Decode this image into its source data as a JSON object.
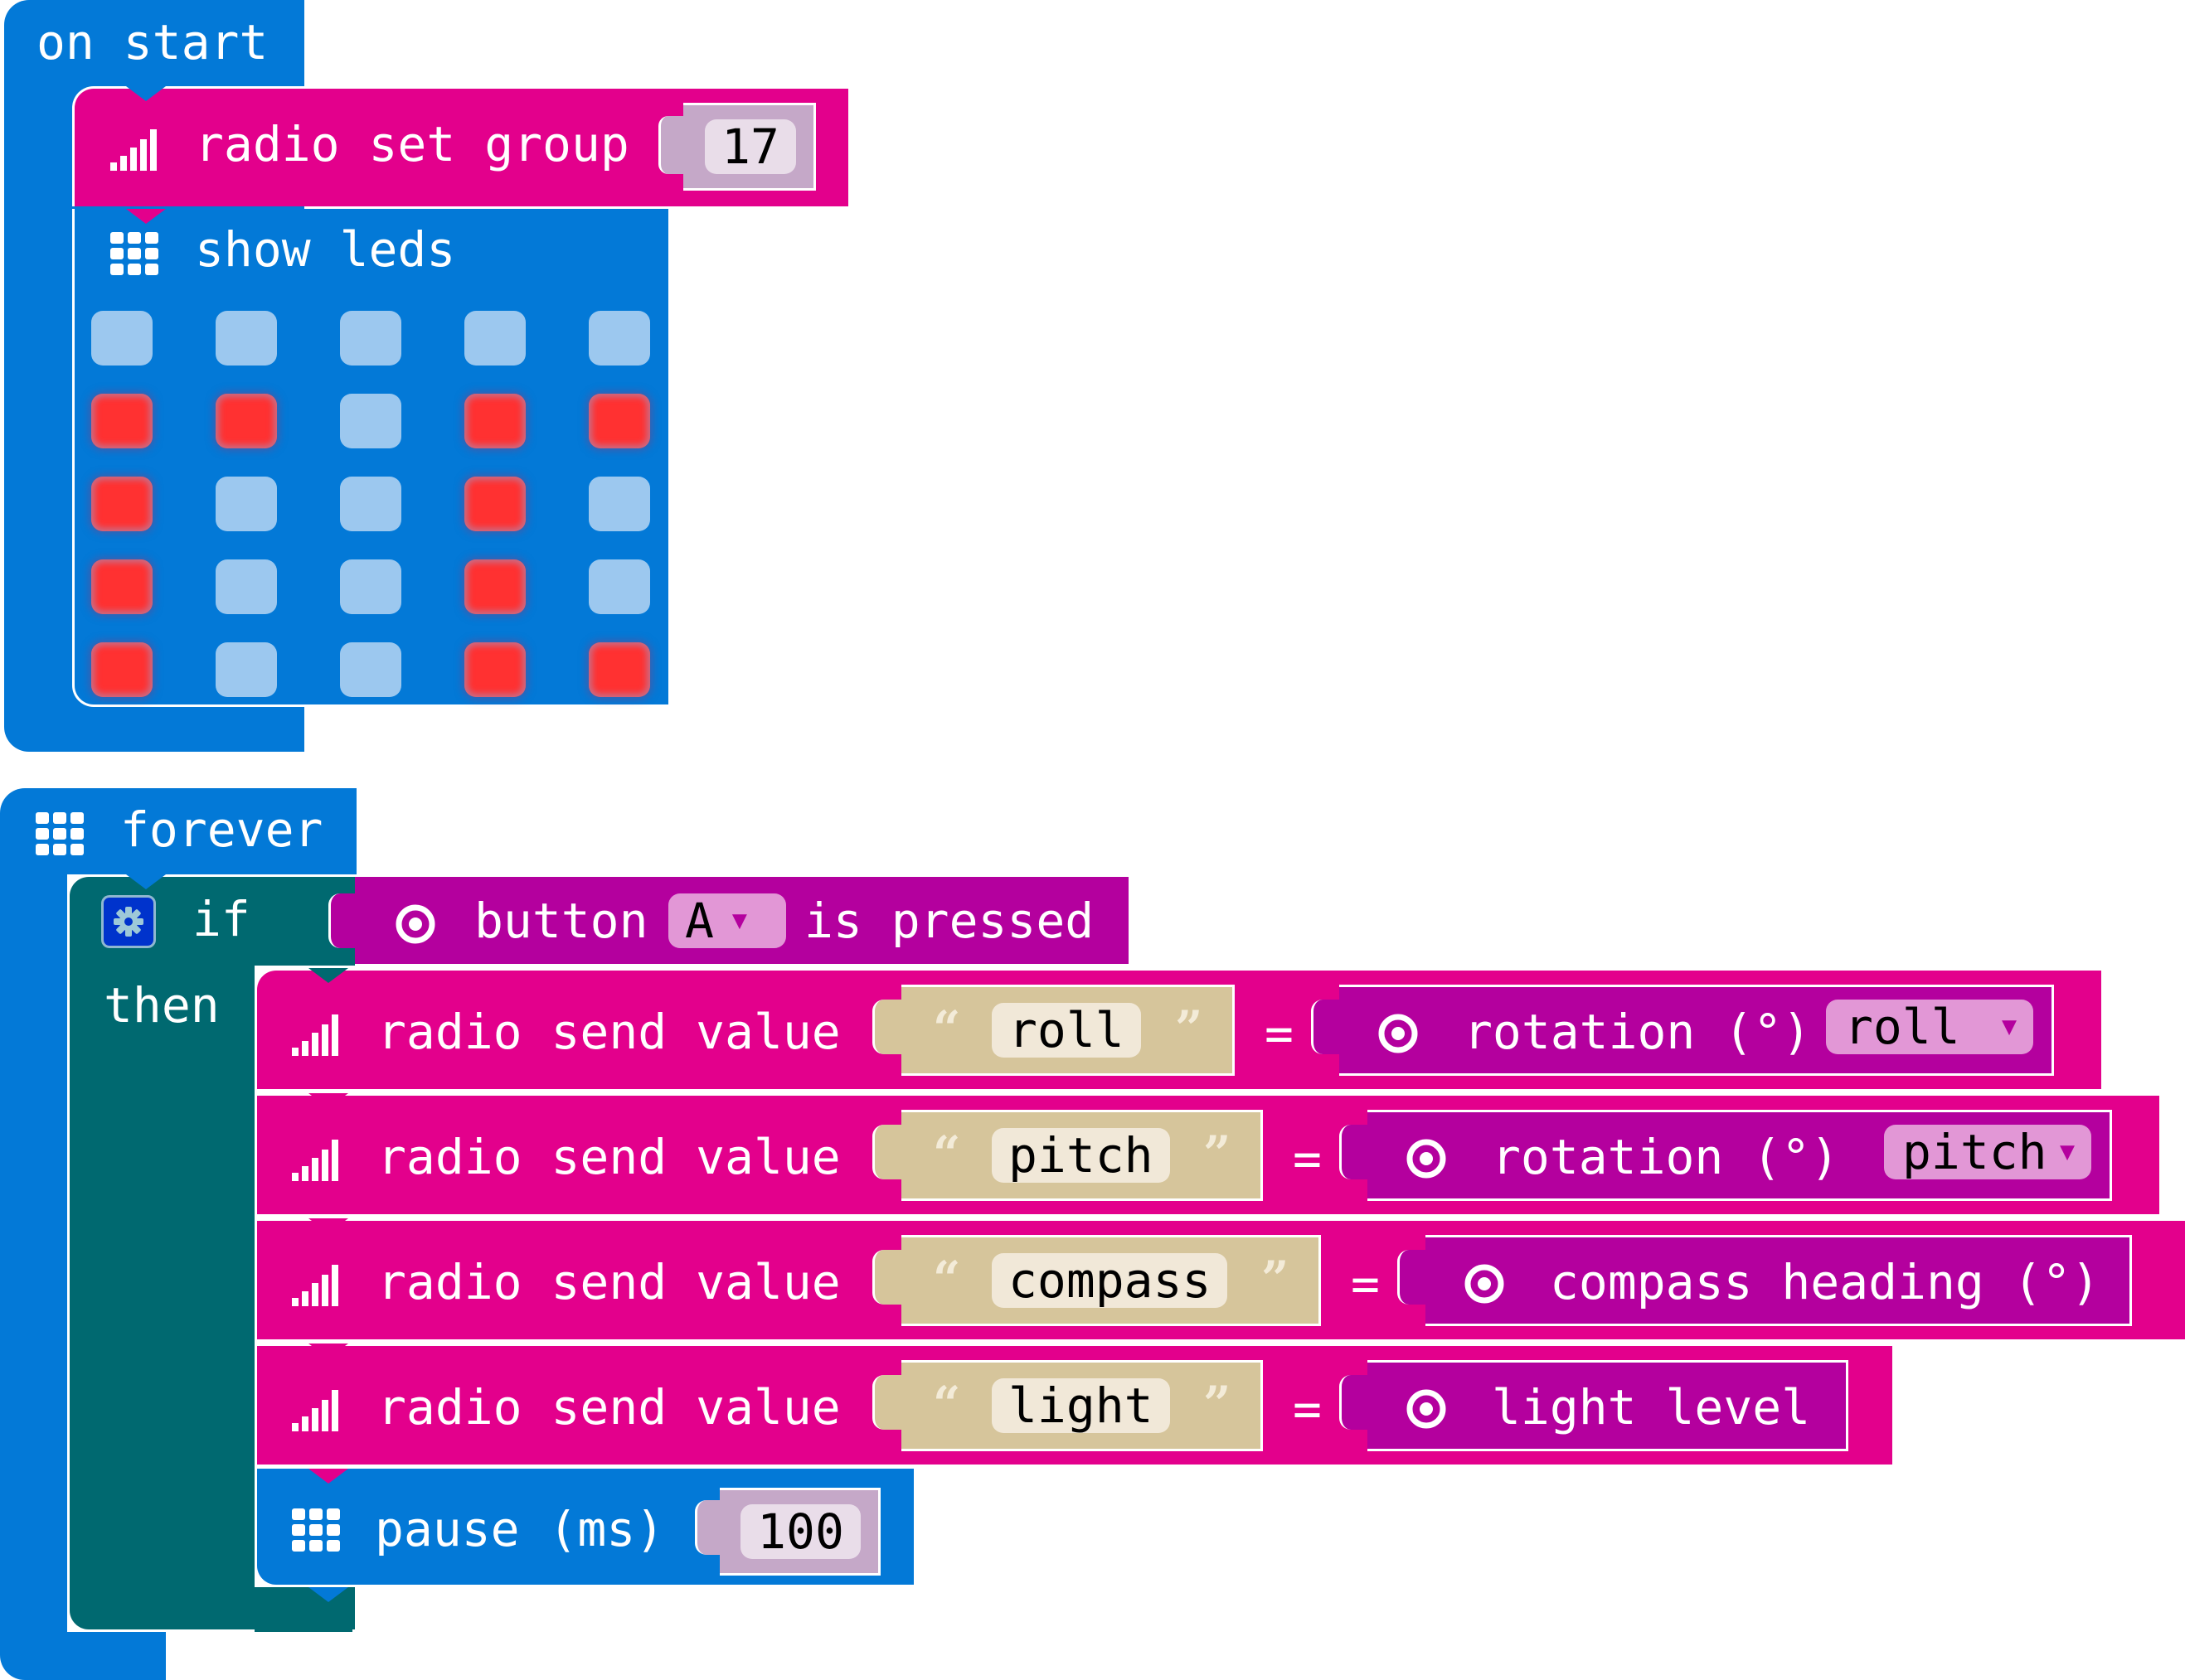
{
  "on_start": {
    "label": "on start",
    "radio_set_group": {
      "label": "radio set group",
      "value": "17",
      "icon": "signal-bars-icon"
    },
    "show_leds": {
      "label": "show leds",
      "icon": "led-grid-icon",
      "grid": [
        [
          0,
          0,
          0,
          0,
          0
        ],
        [
          1,
          1,
          0,
          1,
          1
        ],
        [
          1,
          0,
          0,
          1,
          0
        ],
        [
          1,
          0,
          0,
          1,
          0
        ],
        [
          1,
          0,
          0,
          1,
          1
        ]
      ]
    }
  },
  "forever": {
    "label": "forever",
    "icon": "led-grid-icon",
    "if_block": {
      "if_label": "if",
      "then_label": "then",
      "condition": {
        "pre": "button",
        "dropdown": "A",
        "post": "is pressed",
        "icon": "target-icon"
      },
      "statements": [
        {
          "label": "radio send value",
          "name": "roll",
          "eq": "=",
          "value_label": "rotation (°)",
          "value_dropdown": "roll"
        },
        {
          "label": "radio send value",
          "name": "pitch",
          "eq": "=",
          "value_label": "rotation (°)",
          "value_dropdown": "pitch"
        },
        {
          "label": "radio send value",
          "name": "compass",
          "eq": "=",
          "value_label": "compass heading (°)",
          "value_dropdown": null
        },
        {
          "label": "radio send value",
          "name": "light",
          "eq": "=",
          "value_label": "light level",
          "value_dropdown": null
        }
      ],
      "pause": {
        "label": "pause (ms)",
        "value": "100"
      }
    }
  },
  "quotes": {
    "open": "“",
    "close": "”"
  },
  "colors": {
    "basic_blue": "#0379d7",
    "radio_pink": "#e3008c",
    "logic_teal": "#006970",
    "input_purple": "#b4009e",
    "text_tan": "#d6c59b",
    "number_lavender": "#c5a8c8",
    "led_on": "#ff3131",
    "led_off": "#9cc8ef"
  }
}
